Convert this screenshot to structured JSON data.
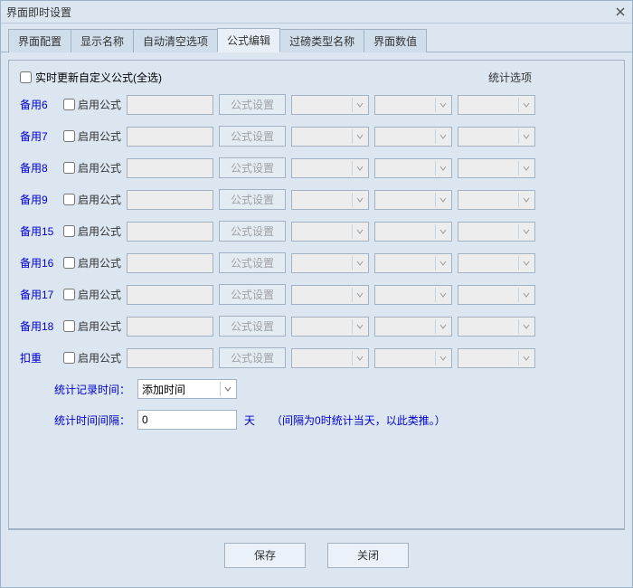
{
  "title": "界面即时设置",
  "tabs": [
    "界面配置",
    "显示名称",
    "自动清空选项",
    "公式编辑",
    "过磅类型名称",
    "界面数值"
  ],
  "active_tab_index": 3,
  "top_checkbox_label": "实时更新自定义公式(全选)",
  "stat_options_label": "统计选项",
  "enable_label": "启用公式",
  "formula_settings_label": "公式设置",
  "rows": [
    {
      "label": "备用6"
    },
    {
      "label": "备用7"
    },
    {
      "label": "备用8"
    },
    {
      "label": "备用9"
    },
    {
      "label": "备用15"
    },
    {
      "label": "备用16"
    },
    {
      "label": "备用17"
    },
    {
      "label": "备用18"
    },
    {
      "label": "扣重"
    }
  ],
  "bottom": {
    "record_time_label": "统计记录时间：",
    "record_time_value": "添加时间",
    "interval_label": "统计时间间隔：",
    "interval_value": "0",
    "interval_unit": "天",
    "interval_hint": "（间隔为0时统计当天，以此类推。）"
  },
  "footer": {
    "save": "保存",
    "close": "关闭"
  }
}
